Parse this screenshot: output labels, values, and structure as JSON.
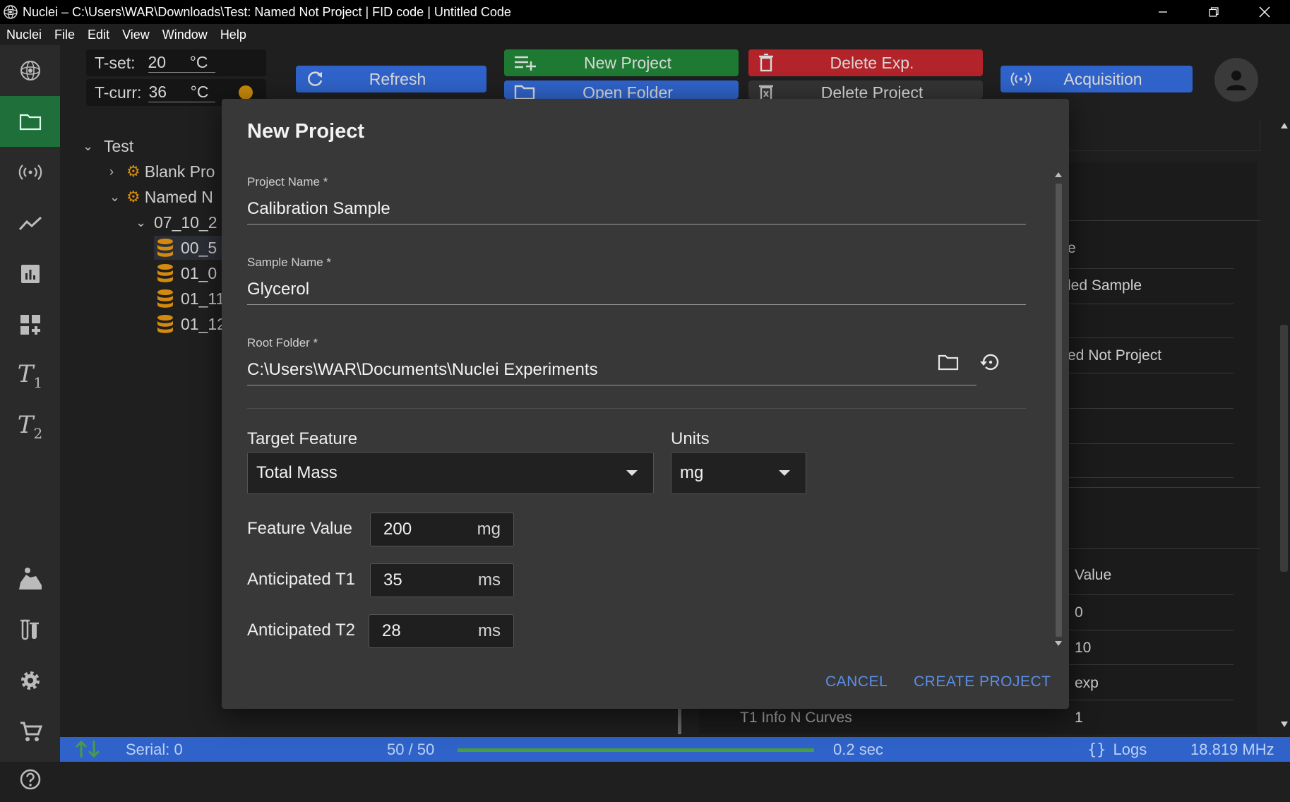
{
  "window": {
    "title": "Nuclei – C:\\Users\\WAR\\Downloads\\Test: Named Not Project | FID code | Untitled Code"
  },
  "menu": [
    "Nuclei",
    "File",
    "Edit",
    "View",
    "Window",
    "Help"
  ],
  "toolbar": {
    "t_set_label": "T-set:",
    "t_set_value": "20",
    "t_unit": "°C",
    "t_curr_label": "T-curr:",
    "t_curr_value": "36",
    "refresh": "Refresh",
    "new_project": "New Project",
    "open_folder": "Open Folder",
    "delete_exp": "Delete Exp.",
    "delete_project": "Delete Project",
    "acquisition": "Acquisition"
  },
  "sidebar": {
    "t1_letter": "T",
    "t1_sub": "1",
    "t2_letter": "T",
    "t2_sub": "2"
  },
  "tree": {
    "root": "Test",
    "items": [
      "Blank Pro",
      "Named N",
      "07_10_2",
      "00_5",
      "01_0",
      "01_11",
      "01_12"
    ]
  },
  "background_panel": {
    "partial_1": "e",
    "partial_2": "led Sample",
    "partial_3": "ed Not Project",
    "value_header": "Value",
    "values": [
      "0",
      "10",
      "exp",
      "1"
    ],
    "t1_info": "T1 Info N Curves"
  },
  "statusbar": {
    "serial": "Serial: 0",
    "count": "50 / 50",
    "progress": 1.0,
    "time": "0.2 sec",
    "logs": "Logs",
    "freq": "18.819 MHz"
  },
  "dialog": {
    "title": "New Project",
    "project_name_label": "Project Name *",
    "project_name_value": "Calibration Sample",
    "sample_name_label": "Sample Name *",
    "sample_name_value": "Glycerol",
    "root_folder_label": "Root Folder *",
    "root_folder_value": "C:\\Users\\WAR\\Documents\\Nuclei Experiments",
    "target_feature_label": "Target Feature",
    "target_feature_value": "Total Mass",
    "units_label": "Units",
    "units_value": "mg",
    "feature_value_label": "Feature Value",
    "feature_value": "200",
    "feature_unit": "mg",
    "t1_label": "Anticipated T1",
    "t1_value": "35",
    "t1_unit": "ms",
    "t2_label": "Anticipated T2",
    "t2_value": "28",
    "t2_unit": "ms",
    "cancel": "CANCEL",
    "create": "CREATE PROJECT"
  },
  "colors": {
    "accent_green": "#1e7a32",
    "accent_blue": "#2f63c9",
    "danger_red": "#b3232a",
    "link_blue": "#5b8fe8",
    "db_icon": "#d38a0f"
  }
}
